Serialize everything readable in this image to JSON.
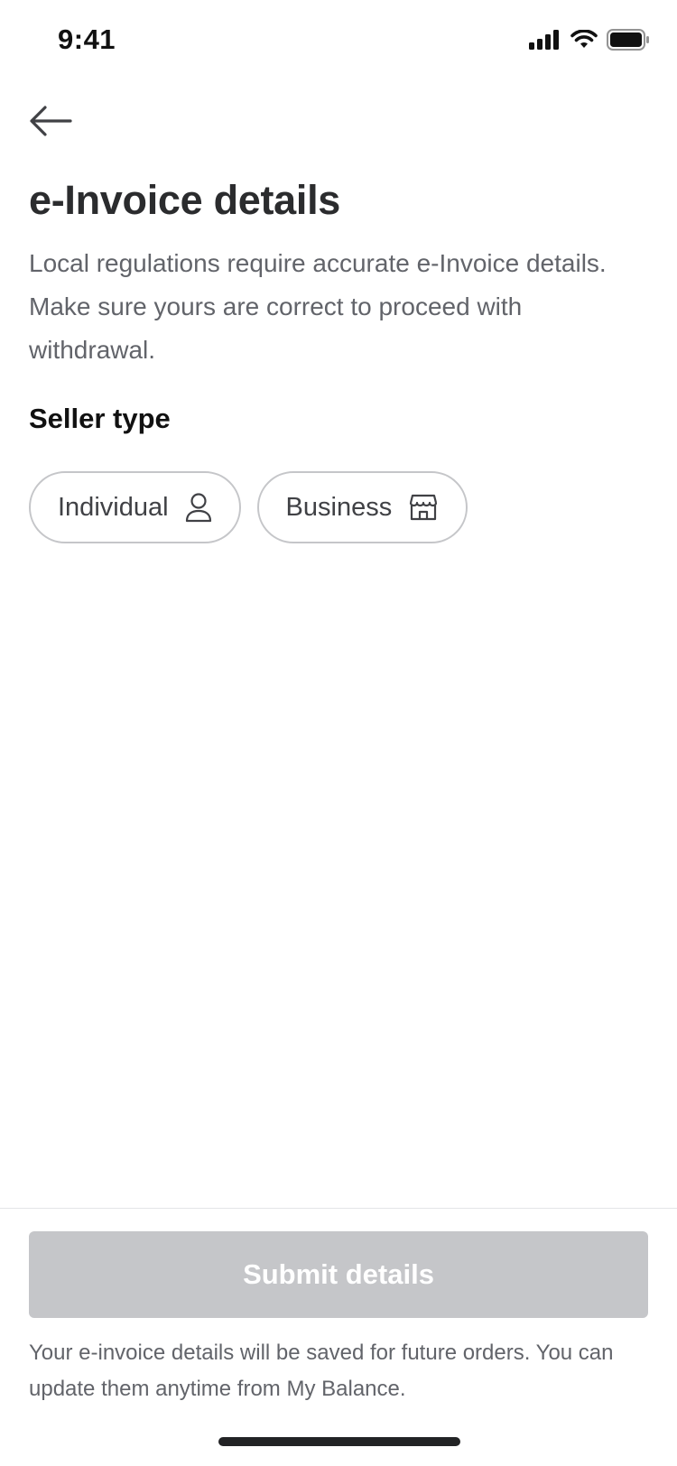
{
  "status_bar": {
    "time": "9:41",
    "icons": [
      "cellular-signal-icon",
      "wifi-icon",
      "battery-icon"
    ]
  },
  "nav": {
    "back_icon": "arrow-left-icon"
  },
  "header": {
    "title": "e-Invoice details",
    "subtitle": "Local regulations require accurate e-Invoice details. Make sure yours are correct to proceed with withdrawal."
  },
  "seller_type": {
    "label": "Seller type",
    "options": [
      {
        "label": "Individual",
        "icon": "person-icon"
      },
      {
        "label": "Business",
        "icon": "storefront-icon"
      }
    ]
  },
  "footer": {
    "submit_label": "Submit details",
    "note": "Your e-invoice details will be saved for future orders. You can update them anytime from My Balance."
  },
  "colors": {
    "text_primary": "#2b2c2e",
    "text_secondary": "#62646a",
    "chip_border": "#c5c6c9",
    "button_disabled_bg": "#c5c6c9",
    "button_text": "#ffffff"
  }
}
